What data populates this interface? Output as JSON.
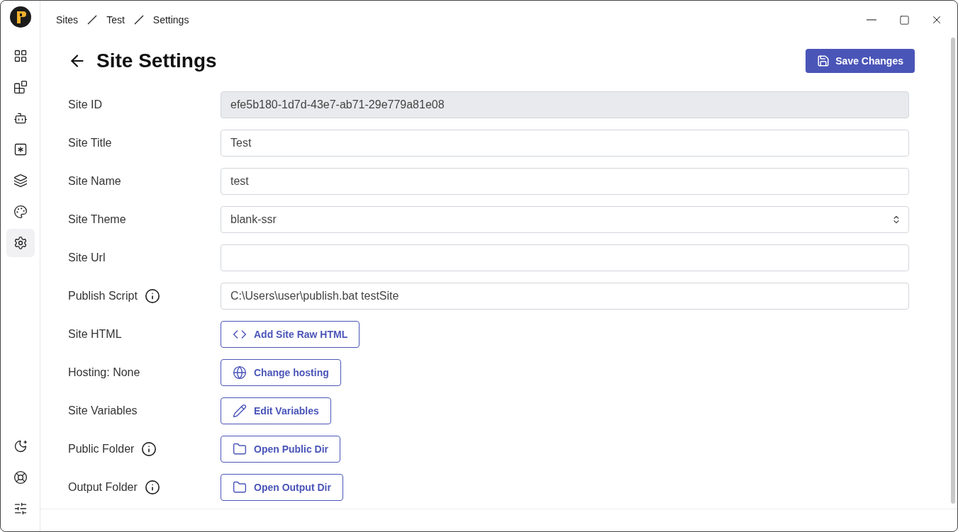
{
  "breadcrumbs": [
    "Sites",
    "Test",
    "Settings"
  ],
  "sidebar": {
    "items": [
      {
        "selected": false
      },
      {
        "selected": false
      },
      {
        "selected": false
      },
      {
        "selected": false
      },
      {
        "selected": false
      },
      {
        "selected": false
      },
      {
        "selected": true
      }
    ],
    "bottom_items": [
      {
        "selected": false
      },
      {
        "selected": false
      },
      {
        "selected": false
      }
    ]
  },
  "page": {
    "title": "Site Settings",
    "save_button": "Save Changes"
  },
  "fields": [
    {
      "label": "Site ID",
      "kind": "input",
      "value": "efe5b180-1d7d-43e7-ab71-29e779a81e08",
      "disabled": true
    },
    {
      "label": "Site Title",
      "kind": "input",
      "value": "Test"
    },
    {
      "label": "Site Name",
      "kind": "input",
      "value": "test"
    },
    {
      "label": "Site Theme",
      "kind": "select",
      "value": "blank-ssr"
    },
    {
      "label": "Site Url",
      "kind": "input"
    },
    {
      "label": "Publish Script",
      "kind": "input",
      "value": "C:\\Users\\user\\publish.bat testSite",
      "info": true
    },
    {
      "label": "Site HTML",
      "kind": "button",
      "value": "Add Site Raw HTML"
    },
    {
      "label": "Hosting: None",
      "kind": "button",
      "value": "Change hosting"
    },
    {
      "label": "Site Variables",
      "kind": "button",
      "value": "Edit Variables"
    },
    {
      "label": "Public Folder",
      "kind": "button",
      "value": "Open Public Dir",
      "info": true
    },
    {
      "label": "Output Folder",
      "kind": "button",
      "value": "Open Output Dir",
      "info": true
    }
  ]
}
